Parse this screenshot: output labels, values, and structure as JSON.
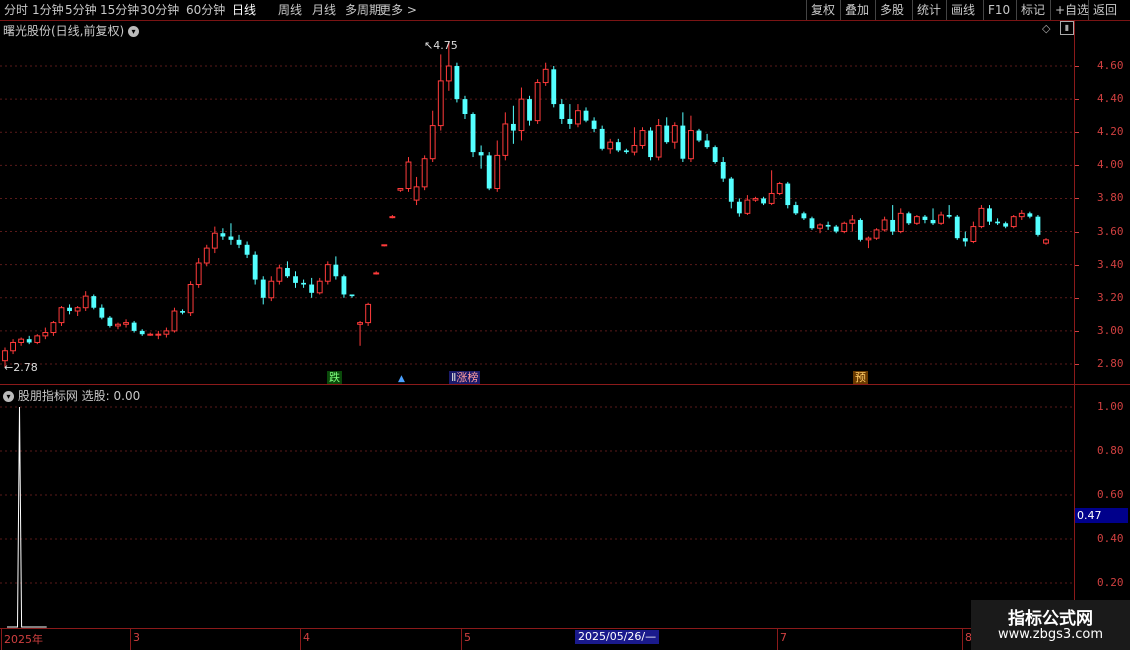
{
  "toolbar": {
    "periods": [
      "分时",
      "1分钟",
      "5分钟",
      "15分钟",
      "30分钟",
      "60分钟",
      "日线",
      "周线",
      "月线",
      "多周期",
      "更多 >"
    ],
    "active_period": "日线",
    "actions": [
      "复权",
      "叠加",
      "多股",
      "统计",
      "画线",
      "F10",
      "标记",
      "+自选",
      "返回"
    ]
  },
  "main_chart": {
    "title": "曙光股份(日线,前复权)",
    "y_ticks": [
      "4.60",
      "4.40",
      "4.20",
      "4.00",
      "3.80",
      "3.60",
      "3.40",
      "3.20",
      "3.00",
      "2.80"
    ],
    "max_label": "4.75",
    "min_label": "2.78",
    "markers": {
      "fall": "跌",
      "list": "涨榜",
      "predict": "预"
    }
  },
  "indicator": {
    "title": "股朋指标网 选股: 0.00",
    "y_ticks": [
      "1.00",
      "0.80",
      "0.60",
      "0.40",
      "0.20"
    ],
    "current_value": "0.47"
  },
  "x_axis": {
    "labels": [
      "2025年",
      "3",
      "4",
      "5",
      "7",
      "8"
    ],
    "cursor_date": "2025/05/26/—"
  },
  "watermark": {
    "line1": "指标公式网",
    "line2": "www.zbgs3.com"
  },
  "chart_data": {
    "type": "candlestick",
    "title": "曙光股份(日线,前复权)",
    "ylim": [
      2.7,
      4.85
    ],
    "up_color": "#ff3b3b",
    "down_color": "#54ffff",
    "candles": [
      [
        2.82,
        2.9,
        2.78,
        2.88
      ],
      [
        2.88,
        2.95,
        2.86,
        2.93
      ],
      [
        2.93,
        2.96,
        2.91,
        2.95
      ],
      [
        2.95,
        2.97,
        2.92,
        2.93
      ],
      [
        2.93,
        2.98,
        2.92,
        2.97
      ],
      [
        2.97,
        3.02,
        2.95,
        2.99
      ],
      [
        2.99,
        3.06,
        2.97,
        3.05
      ],
      [
        3.05,
        3.15,
        3.03,
        3.14
      ],
      [
        3.14,
        3.16,
        3.1,
        3.12
      ],
      [
        3.12,
        3.15,
        3.09,
        3.14
      ],
      [
        3.14,
        3.24,
        3.12,
        3.21
      ],
      [
        3.21,
        3.22,
        3.13,
        3.14
      ],
      [
        3.14,
        3.16,
        3.07,
        3.08
      ],
      [
        3.08,
        3.09,
        3.02,
        3.03
      ],
      [
        3.03,
        3.05,
        3.01,
        3.04
      ],
      [
        3.04,
        3.07,
        3.02,
        3.05
      ],
      [
        3.05,
        3.06,
        2.99,
        3.0
      ],
      [
        3.0,
        3.01,
        2.97,
        2.98
      ],
      [
        2.98,
        2.99,
        2.97,
        2.98
      ],
      [
        2.98,
        3.0,
        2.95,
        2.98
      ],
      [
        2.98,
        3.02,
        2.96,
        3.0
      ],
      [
        3.0,
        3.14,
        2.99,
        3.12
      ],
      [
        3.12,
        3.13,
        3.1,
        3.11
      ],
      [
        3.11,
        3.3,
        3.09,
        3.28
      ],
      [
        3.28,
        3.44,
        3.26,
        3.41
      ],
      [
        3.41,
        3.52,
        3.39,
        3.5
      ],
      [
        3.5,
        3.63,
        3.47,
        3.59
      ],
      [
        3.59,
        3.62,
        3.55,
        3.57
      ],
      [
        3.57,
        3.65,
        3.52,
        3.55
      ],
      [
        3.55,
        3.58,
        3.5,
        3.52
      ],
      [
        3.52,
        3.54,
        3.44,
        3.46
      ],
      [
        3.46,
        3.48,
        3.28,
        3.31
      ],
      [
        3.31,
        3.33,
        3.16,
        3.2
      ],
      [
        3.2,
        3.33,
        3.18,
        3.3
      ],
      [
        3.3,
        3.4,
        3.28,
        3.38
      ],
      [
        3.38,
        3.42,
        3.32,
        3.33
      ],
      [
        3.33,
        3.36,
        3.26,
        3.29
      ],
      [
        3.29,
        3.31,
        3.26,
        3.28
      ],
      [
        3.28,
        3.32,
        3.2,
        3.23
      ],
      [
        3.23,
        3.32,
        3.22,
        3.3
      ],
      [
        3.3,
        3.42,
        3.28,
        3.4
      ],
      [
        3.4,
        3.45,
        3.31,
        3.33
      ],
      [
        3.33,
        3.34,
        3.2,
        3.22
      ],
      [
        3.22,
        3.22,
        3.2,
        3.21
      ],
      [
        3.04,
        3.06,
        2.91,
        3.05
      ],
      [
        3.05,
        3.17,
        3.03,
        3.16
      ],
      [
        3.35,
        3.36,
        3.34,
        3.35
      ],
      [
        3.52,
        3.52,
        3.51,
        3.52
      ],
      [
        3.69,
        3.7,
        3.68,
        3.69
      ],
      [
        3.85,
        3.86,
        3.84,
        3.86
      ],
      [
        3.86,
        4.05,
        3.84,
        4.02
      ],
      [
        3.79,
        3.93,
        3.76,
        3.87
      ],
      [
        3.87,
        4.06,
        3.85,
        4.04
      ],
      [
        4.04,
        4.33,
        4.02,
        4.24
      ],
      [
        4.24,
        4.67,
        4.21,
        4.51
      ],
      [
        4.51,
        4.75,
        4.45,
        4.6
      ],
      [
        4.6,
        4.62,
        4.38,
        4.4
      ],
      [
        4.4,
        4.42,
        4.28,
        4.31
      ],
      [
        4.31,
        4.32,
        4.05,
        4.08
      ],
      [
        4.08,
        4.12,
        3.98,
        4.06
      ],
      [
        4.06,
        4.08,
        3.85,
        3.86
      ],
      [
        3.86,
        4.15,
        3.84,
        4.06
      ],
      [
        4.06,
        4.32,
        4.03,
        4.25
      ],
      [
        4.25,
        4.36,
        4.13,
        4.21
      ],
      [
        4.21,
        4.47,
        4.15,
        4.4
      ],
      [
        4.4,
        4.42,
        4.24,
        4.27
      ],
      [
        4.27,
        4.52,
        4.25,
        4.5
      ],
      [
        4.5,
        4.62,
        4.48,
        4.58
      ],
      [
        4.58,
        4.6,
        4.35,
        4.37
      ],
      [
        4.37,
        4.4,
        4.25,
        4.28
      ],
      [
        4.28,
        4.37,
        4.22,
        4.25
      ],
      [
        4.25,
        4.37,
        4.23,
        4.33
      ],
      [
        4.33,
        4.35,
        4.26,
        4.27
      ],
      [
        4.27,
        4.29,
        4.2,
        4.22
      ],
      [
        4.22,
        4.24,
        4.09,
        4.1
      ],
      [
        4.1,
        4.16,
        4.07,
        4.14
      ],
      [
        4.14,
        4.16,
        4.08,
        4.09
      ],
      [
        4.09,
        4.1,
        4.07,
        4.08
      ],
      [
        4.08,
        4.23,
        4.06,
        4.12
      ],
      [
        4.12,
        4.23,
        4.1,
        4.21
      ],
      [
        4.21,
        4.23,
        4.03,
        4.05
      ],
      [
        4.05,
        4.28,
        4.03,
        4.24
      ],
      [
        4.24,
        4.29,
        4.13,
        4.14
      ],
      [
        4.14,
        4.26,
        4.1,
        4.24
      ],
      [
        4.24,
        4.32,
        4.02,
        4.04
      ],
      [
        4.04,
        4.3,
        4.02,
        4.21
      ],
      [
        4.21,
        4.22,
        4.14,
        4.15
      ],
      [
        4.15,
        4.19,
        4.1,
        4.11
      ],
      [
        4.11,
        4.12,
        4.01,
        4.02
      ],
      [
        4.02,
        4.05,
        3.9,
        3.92
      ],
      [
        3.92,
        3.93,
        3.74,
        3.78
      ],
      [
        3.78,
        3.8,
        3.69,
        3.71
      ],
      [
        3.71,
        3.82,
        3.7,
        3.79
      ],
      [
        3.79,
        3.81,
        3.78,
        3.8
      ],
      [
        3.8,
        3.81,
        3.76,
        3.77
      ],
      [
        3.77,
        3.97,
        3.76,
        3.83
      ],
      [
        3.83,
        3.9,
        3.82,
        3.89
      ],
      [
        3.89,
        3.9,
        3.74,
        3.76
      ],
      [
        3.76,
        3.78,
        3.7,
        3.71
      ],
      [
        3.71,
        3.72,
        3.67,
        3.68
      ],
      [
        3.68,
        3.69,
        3.61,
        3.62
      ],
      [
        3.62,
        3.65,
        3.59,
        3.64
      ],
      [
        3.64,
        3.66,
        3.61,
        3.63
      ],
      [
        3.63,
        3.64,
        3.59,
        3.6
      ],
      [
        3.6,
        3.66,
        3.59,
        3.65
      ],
      [
        3.65,
        3.7,
        3.6,
        3.67
      ],
      [
        3.67,
        3.68,
        3.54,
        3.55
      ],
      [
        3.55,
        3.57,
        3.5,
        3.56
      ],
      [
        3.56,
        3.62,
        3.55,
        3.61
      ],
      [
        3.61,
        3.69,
        3.6,
        3.67
      ],
      [
        3.67,
        3.76,
        3.58,
        3.6
      ],
      [
        3.6,
        3.74,
        3.59,
        3.71
      ],
      [
        3.71,
        3.72,
        3.64,
        3.65
      ],
      [
        3.65,
        3.7,
        3.64,
        3.69
      ],
      [
        3.69,
        3.7,
        3.65,
        3.67
      ],
      [
        3.67,
        3.74,
        3.64,
        3.65
      ],
      [
        3.65,
        3.72,
        3.64,
        3.7
      ],
      [
        3.7,
        3.76,
        3.68,
        3.69
      ],
      [
        3.69,
        3.7,
        3.55,
        3.56
      ],
      [
        3.56,
        3.6,
        3.51,
        3.54
      ],
      [
        3.54,
        3.66,
        3.53,
        3.63
      ],
      [
        3.63,
        3.76,
        3.62,
        3.74
      ],
      [
        3.74,
        3.76,
        3.64,
        3.66
      ],
      [
        3.66,
        3.68,
        3.64,
        3.65
      ],
      [
        3.65,
        3.66,
        3.62,
        3.63
      ],
      [
        3.63,
        3.7,
        3.62,
        3.69
      ],
      [
        3.69,
        3.73,
        3.67,
        3.71
      ],
      [
        3.71,
        3.72,
        3.68,
        3.69
      ],
      [
        3.69,
        3.7,
        3.57,
        3.58
      ],
      [
        3.53,
        3.56,
        3.52,
        3.55
      ]
    ],
    "indicator_series": {
      "name": "选股",
      "values": [
        0,
        0,
        0,
        0,
        0,
        0,
        1,
        0,
        0,
        0,
        0,
        0,
        0,
        0,
        0,
        0,
        0,
        0,
        0,
        0
      ]
    }
  }
}
